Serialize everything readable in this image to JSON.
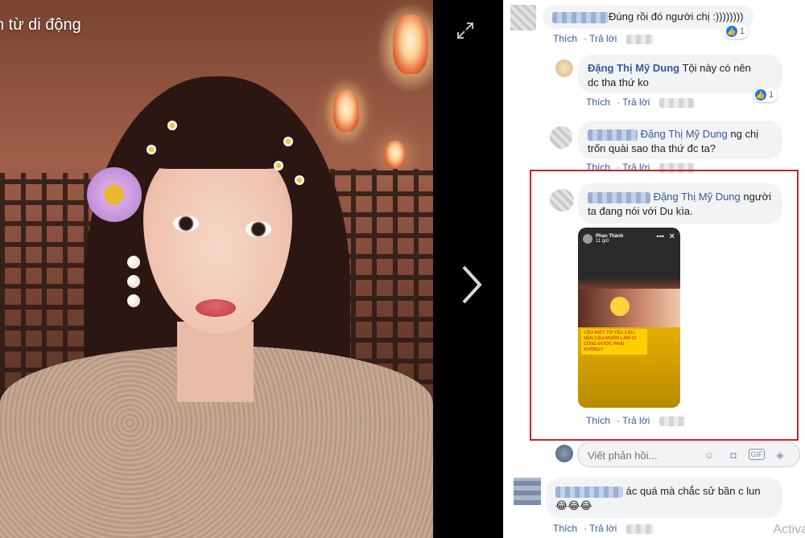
{
  "viewer": {
    "caption": "n từ di động",
    "expand_icon": "expand-icon",
    "next_icon": "chevron-right-icon"
  },
  "comments": [
    {
      "text": "Đúng rồi đó người chị :))))))))",
      "actions": {
        "like": "Thích",
        "reply": "Trả lời"
      },
      "likes": "1"
    },
    {
      "author": "Đặng Thị Mỹ Dung",
      "text_line1": "Tội này có nên",
      "text_line2": "dc tha thứ ko",
      "actions": {
        "like": "Thích",
        "reply": "Trả lời"
      },
      "likes": "1"
    },
    {
      "tag": "Đặng Thị Mỹ Dung",
      "text_line1": "ng chị",
      "text_line2": "trốn quài sao tha thứ đc ta?",
      "actions": {
        "like": "Thích",
        "reply": "Trả lời"
      }
    },
    {
      "tag": "Đặng Thị Mỹ Dung",
      "text_line1": "người",
      "text_line2": "ta đang nói với Du kìa.",
      "story": {
        "author": "Phan Thành",
        "time": "11 giờ",
        "caption": "CẬU BIẾT TỚ YÊU CẬU, NÊN CẬU MUỐN LÀM GÌ CŨNG ĐƯỢC PHẢI KHÔNG?"
      },
      "actions": {
        "like": "Thích",
        "reply": "Trả lời"
      }
    },
    {
      "text": "ác quá mà chắc sử bần c lun",
      "emojis": "😂😂😂",
      "actions": {
        "like": "Thích",
        "reply": "Trả lời"
      }
    }
  ],
  "reply_box": {
    "placeholder": "Viết phản hồi...",
    "icons": [
      "emoji-icon",
      "camera-icon",
      "gif-icon",
      "sticker-icon"
    ],
    "gif_label": "GIF"
  },
  "watermark": "Activa",
  "colors": {
    "link": "#385898",
    "highlight_border": "#d0202a",
    "bubble": "#f2f3f5"
  }
}
